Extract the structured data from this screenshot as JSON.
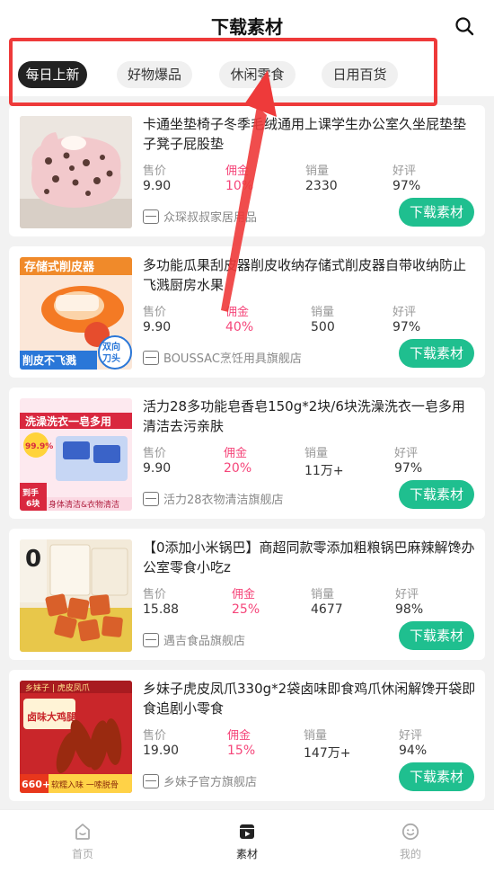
{
  "header": {
    "title": "下载素材",
    "search_icon": "search-icon"
  },
  "tabs": [
    {
      "label": "每日上新",
      "active": true
    },
    {
      "label": "好物爆品",
      "active": false
    },
    {
      "label": "休闲零食",
      "active": false
    },
    {
      "label": "日用百货",
      "active": false
    }
  ],
  "stat_labels": {
    "price": "售价",
    "commission": "佣金",
    "sales": "销量",
    "rating": "好评"
  },
  "download_label": "下载素材",
  "products": [
    {
      "title": "卡通坐垫椅子冬季毛绒通用上课学生办公室久坐屁垫垫子凳子屁股垫",
      "price": "9.90",
      "commission": "10%",
      "sales": "2330",
      "rating": "97%",
      "shop": "众琛叔叔家居用品",
      "thumb_text": []
    },
    {
      "title": "多功能瓜果刮皮器削皮收纳存储式削皮器自带收纳防止飞溅厨房水果",
      "price": "9.90",
      "commission": "40%",
      "sales": "500",
      "rating": "97%",
      "shop": "BOUSSAC烹饪用具旗舰店",
      "thumb_text": [
        "存储式削皮器",
        "削皮不飞溅",
        "双向刀头"
      ]
    },
    {
      "title": "活力28多功能皂香皂150g*2块/6块洗澡洗衣一皂多用清洁去污亲肤",
      "price": "9.90",
      "commission": "20%",
      "sales": "11万+",
      "rating": "97%",
      "shop": "活力28衣物清洁旗舰店",
      "thumb_text": [
        "洗澡洗衣一皂多用",
        "99.9%",
        "到手6块",
        "身体清洁&衣物清洁"
      ]
    },
    {
      "title": "【0添加小米锅巴】商超同款零添加粗粮锅巴麻辣解馋办公室零食小吃z",
      "price": "15.88",
      "commission": "25%",
      "sales": "4677",
      "rating": "98%",
      "shop": "遇吉食品旗舰店",
      "thumb_text": [
        "0"
      ]
    },
    {
      "title": "乡妹子虎皮凤爪330g*2袋卤味即食鸡爪休闲解馋开袋即食追剧小零食",
      "price": "19.90",
      "commission": "15%",
      "sales": "147万+",
      "rating": "94%",
      "shop": "乡妹子官方旗舰店",
      "thumb_text": [
        "卤味大鸡腿",
        "660+",
        "软糯入味 一嗦脱骨"
      ]
    }
  ],
  "nav": [
    {
      "label": "首页",
      "icon": "home-icon",
      "active": false
    },
    {
      "label": "素材",
      "icon": "material-icon",
      "active": true
    },
    {
      "label": "我的",
      "icon": "profile-icon",
      "active": false
    }
  ],
  "colors": {
    "accent": "#1fbf8f",
    "commission": "#f5467a",
    "highlight": "#ee3a3a"
  }
}
